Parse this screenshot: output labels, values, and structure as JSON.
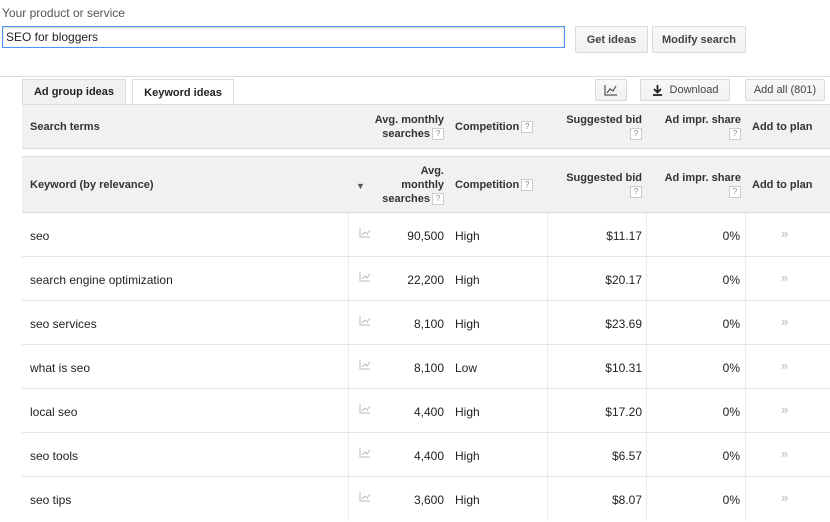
{
  "search": {
    "label": "Your product or service",
    "value": "SEO for bloggers"
  },
  "buttons": {
    "get_ideas": "Get ideas",
    "modify_search": "Modify search",
    "download": "Download",
    "add_all": "Add all (801)"
  },
  "tabs": [
    {
      "label": "Ad group ideas",
      "active": false
    },
    {
      "label": "Keyword ideas",
      "active": true
    }
  ],
  "search_terms_header": {
    "col1": "Search terms",
    "avg_monthly": "Avg. monthly searches",
    "avg_line1": "Avg. monthly",
    "avg_line2": "searches",
    "competition": "Competition",
    "suggested_bid": "Suggested bid",
    "ad_impr": "Ad impr. share",
    "add_to_plan": "Add to plan"
  },
  "keyword_header": {
    "col1": "Keyword (by relevance)",
    "avg_line1": "Avg.",
    "avg_line2": "monthly",
    "avg_line3": "searches",
    "competition": "Competition",
    "suggested_bid": "Suggested bid",
    "ad_impr": "Ad impr. share",
    "add_to_plan": "Add to plan"
  },
  "help_glyph": "?",
  "icons": {
    "sort": "sort-down-icon",
    "chart": "trend-chart-icon",
    "add": "add-to-plan-chevron-icon",
    "download": "download-icon"
  },
  "rows": [
    {
      "keyword": "seo",
      "searches": "90,500",
      "competition": "High",
      "bid": "$11.17",
      "share": "0%"
    },
    {
      "keyword": "search engine optimization",
      "searches": "22,200",
      "competition": "High",
      "bid": "$20.17",
      "share": "0%"
    },
    {
      "keyword": "seo services",
      "searches": "8,100",
      "competition": "High",
      "bid": "$23.69",
      "share": "0%"
    },
    {
      "keyword": "what is seo",
      "searches": "8,100",
      "competition": "Low",
      "bid": "$10.31",
      "share": "0%"
    },
    {
      "keyword": "local seo",
      "searches": "4,400",
      "competition": "High",
      "bid": "$17.20",
      "share": "0%"
    },
    {
      "keyword": "seo tools",
      "searches": "4,400",
      "competition": "High",
      "bid": "$6.57",
      "share": "0%"
    },
    {
      "keyword": "seo tips",
      "searches": "3,600",
      "competition": "High",
      "bid": "$8.07",
      "share": "0%"
    }
  ]
}
